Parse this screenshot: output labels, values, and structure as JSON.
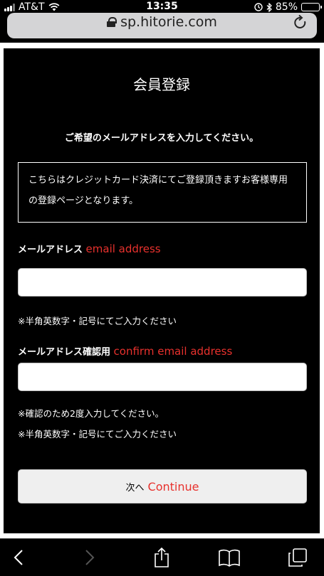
{
  "status_bar": {
    "carrier": "AT&T",
    "time": "13:35",
    "battery": "85%",
    "battery_level": 85
  },
  "browser": {
    "url": "sp.hitorie.com"
  },
  "page": {
    "title": "会員登録",
    "instruction": "ご希望のメールアドレスを入力してください。",
    "notice": "こちらはクレジットカード決済にてご登録頂きますお客様専用の登録ページとなります。",
    "email_label_ja": "メールアドレス",
    "email_label_en": "email address",
    "email_value": "",
    "email_hint": "※半角英数字・記号にてご入力ください",
    "confirm_label_ja": "メールアドレス確認用",
    "confirm_label_en": "confirm email address",
    "confirm_value": "",
    "confirm_hint1": "※確認のため2度入力してください。",
    "confirm_hint2": "※半角英数字・記号にてご入力ください",
    "continue_ja": "次へ",
    "continue_en": "Continue"
  },
  "colors": {
    "accent_red": "#e8312d",
    "background": "#000000"
  },
  "icons": [
    "signal-icon",
    "wifi-icon",
    "lock-icon",
    "reload-icon",
    "alarm-icon",
    "bluetooth-icon",
    "battery-icon",
    "back-icon",
    "forward-icon",
    "share-icon",
    "bookmarks-icon",
    "tabs-icon"
  ]
}
